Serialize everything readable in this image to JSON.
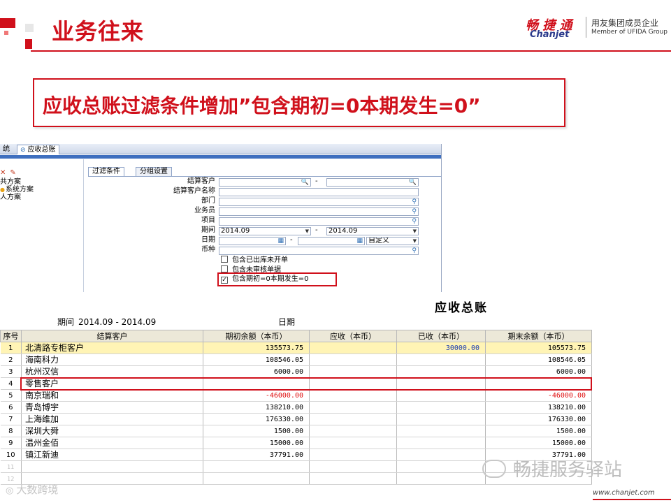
{
  "slide": {
    "title": "业务往来",
    "headline": "应收总账过滤条件增加”包含期初=0本期发生=0”",
    "logo": {
      "brand_cn": "畅 捷 通",
      "brand_en": "Chanjet",
      "tagline_cn": "用友集团成员企业",
      "tagline_en": "Member of UFIDA Group"
    },
    "accent_color": "#d0101b"
  },
  "window": {
    "tabs": [
      "统",
      "应收总账"
    ],
    "tree": {
      "toolbar": [
        "✕",
        "✎"
      ],
      "items": [
        "共方案",
        "系统方案",
        "人方案"
      ]
    },
    "subtabs": [
      "过滤条件",
      "分组设置"
    ],
    "filter": {
      "fields": {
        "customer": "结算客户",
        "customer_name": "结算客户名称",
        "department": "部门",
        "salesperson": "业务员",
        "project": "项目",
        "period": "期间",
        "date": "日期",
        "currency": "币种"
      },
      "period_from": "2014.09",
      "period_to": "2014.09",
      "date_mode": "自定义",
      "separator": "-",
      "checkboxes": [
        {
          "label": "包含已出库未开单",
          "checked": false
        },
        {
          "label": "包含未审核单据",
          "checked": false
        },
        {
          "label": "包含期初=0本期发生=0",
          "checked": true
        }
      ]
    },
    "icons": [
      "search-icon",
      "lookup-icon",
      "calendar-icon",
      "dropdown-icon",
      "checkmark-icon"
    ]
  },
  "report": {
    "title": "应收总账",
    "period_label": "期间",
    "period_value": "2014.09 - 2014.09",
    "date_label": "日期",
    "columns": [
      "序号",
      "结算客户",
      "期初余额（本币）",
      "应收（本币）",
      "已收（本币）",
      "期末余额（本币）"
    ],
    "rows": [
      {
        "no": "1",
        "customer": "北清路专柜客户",
        "opening": "135573.75",
        "receivable": "",
        "received": "30000.00",
        "closing": "105573.75"
      },
      {
        "no": "2",
        "customer": "海南科力",
        "opening": "108546.05",
        "receivable": "",
        "received": "",
        "closing": "108546.05"
      },
      {
        "no": "3",
        "customer": "杭州汉信",
        "opening": "6000.00",
        "receivable": "",
        "received": "",
        "closing": "6000.00"
      },
      {
        "no": "4",
        "customer": "零售客户",
        "opening": "",
        "receivable": "",
        "received": "",
        "closing": ""
      },
      {
        "no": "5",
        "customer": "南京瑞和",
        "opening": "-46000.00",
        "receivable": "",
        "received": "",
        "closing": "-46000.00"
      },
      {
        "no": "6",
        "customer": "青岛博宇",
        "opening": "138210.00",
        "receivable": "",
        "received": "",
        "closing": "138210.00"
      },
      {
        "no": "7",
        "customer": "上海维加",
        "opening": "176330.00",
        "receivable": "",
        "received": "",
        "closing": "176330.00"
      },
      {
        "no": "8",
        "customer": "深圳大舜",
        "opening": "1500.00",
        "receivable": "",
        "received": "",
        "closing": "1500.00"
      },
      {
        "no": "9",
        "customer": "温州金佰",
        "opening": "15000.00",
        "receivable": "",
        "received": "",
        "closing": "15000.00"
      },
      {
        "no": "10",
        "customer": "镇江新迪",
        "opening": "37791.00",
        "receivable": "",
        "received": "",
        "closing": "37791.00"
      },
      {
        "no": "11",
        "customer": "",
        "opening": "",
        "receivable": "",
        "received": "",
        "closing": ""
      },
      {
        "no": "12",
        "customer": "",
        "opening": "",
        "receivable": "",
        "received": "",
        "closing": ""
      }
    ],
    "negative_color": "#e01010",
    "selected_row_color": "#fff4b5"
  },
  "watermarks": {
    "left": "大数跨境",
    "right": "畅捷服务驿站",
    "url": "www.chanjet.com"
  }
}
